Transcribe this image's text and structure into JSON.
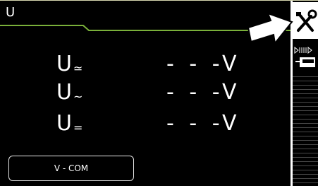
{
  "header": {
    "title": "U"
  },
  "measurements": [
    {
      "symbol": "U",
      "subscript": "≃",
      "value": "- - -",
      "unit": "V"
    },
    {
      "symbol": "U",
      "subscript": "~",
      "value": "- - -",
      "unit": "V"
    },
    {
      "symbol": "U",
      "subscript": "=",
      "value": "- - -",
      "unit": "V"
    }
  ],
  "terminal_button": {
    "label": "V - COM"
  },
  "sidebar": {
    "settings_icon": "wrench-screwdriver-icon",
    "mode_icon": "battery-probe-icon"
  },
  "colors": {
    "accent_line": "#7ab03a",
    "background": "#000000",
    "text": "#ffffff"
  }
}
